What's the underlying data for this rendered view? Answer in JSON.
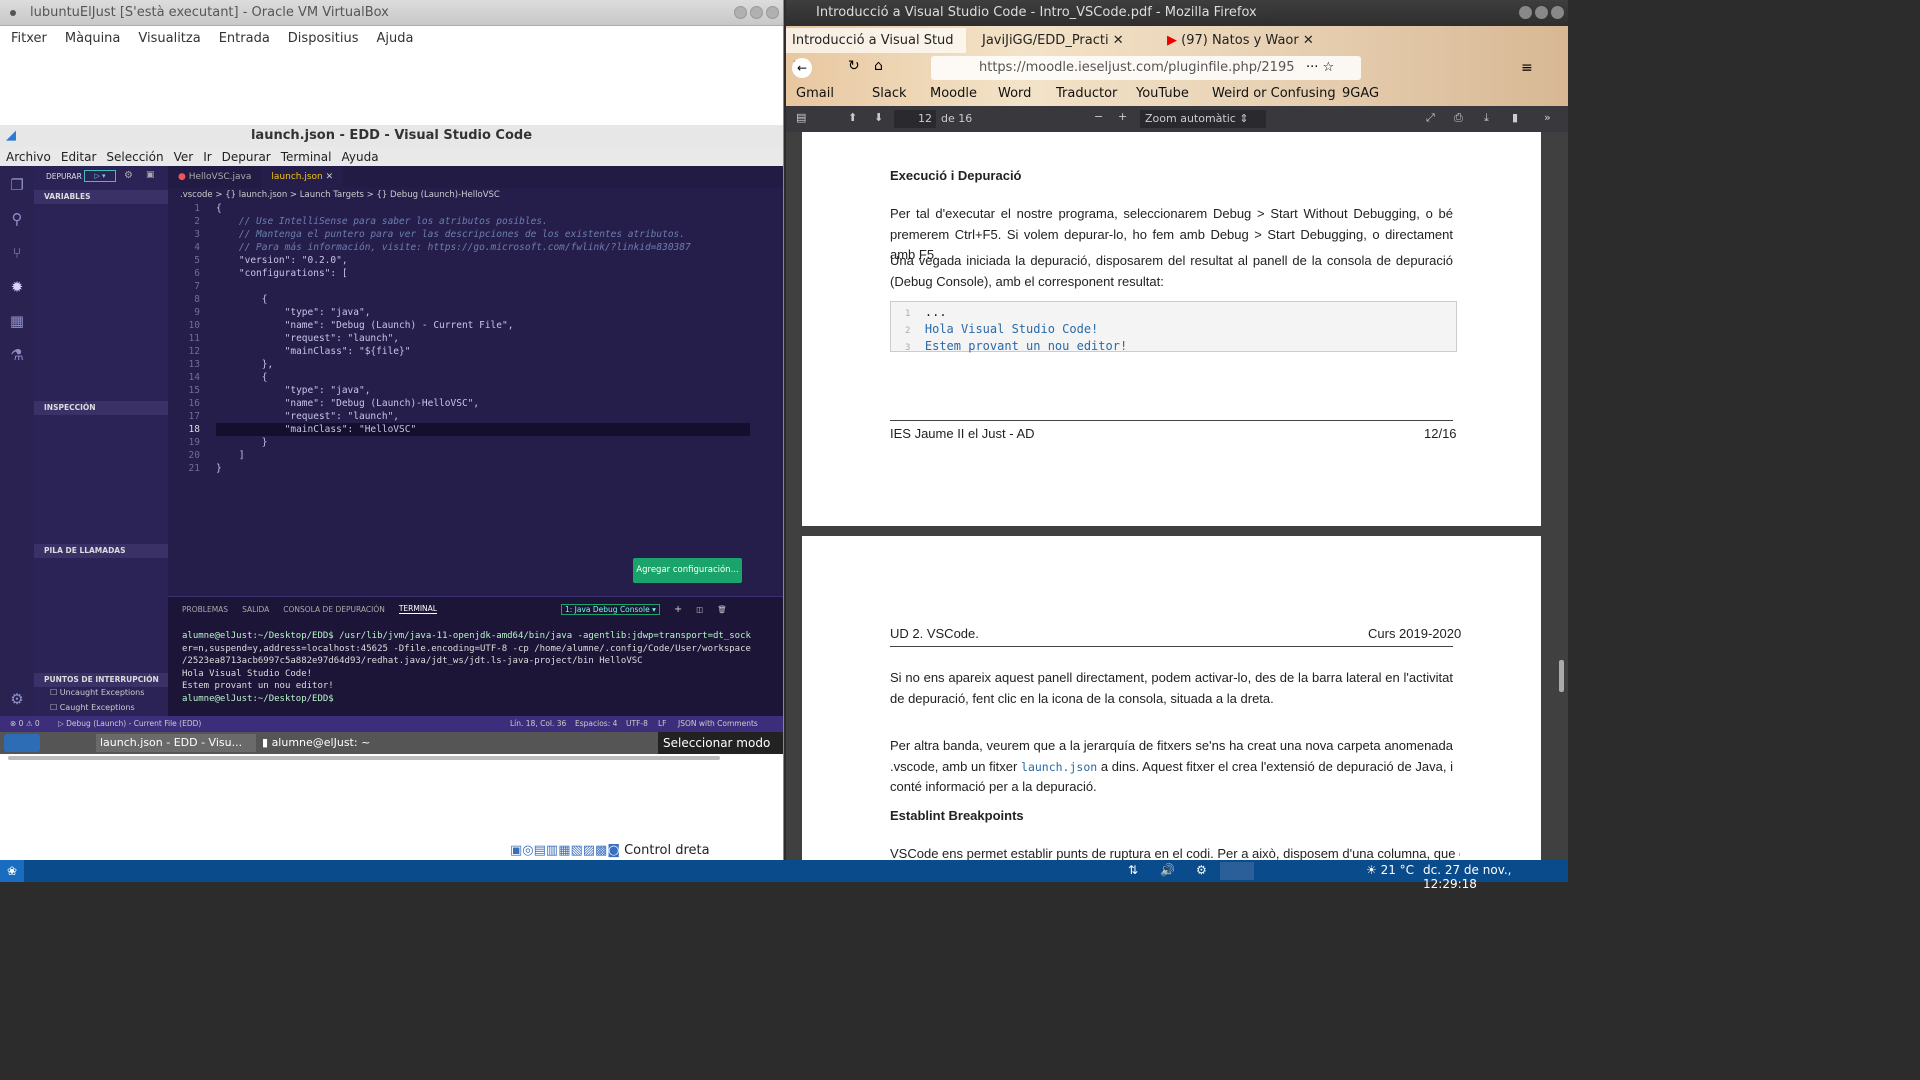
{
  "vbox": {
    "title": "lubuntuElJust [S'està executant] - Oracle VM VirtualBox",
    "menu": [
      "Fitxer",
      "Màquina",
      "Visualitza",
      "Entrada",
      "Dispositius",
      "Ajuda"
    ],
    "hostkey": "Control dreta"
  },
  "vscode": {
    "title": "launch.json - EDD - Visual Studio Code",
    "menu": [
      "Archivo",
      "Editar",
      "Selección",
      "Ver",
      "Ir",
      "Depurar",
      "Terminal",
      "Ayuda"
    ],
    "debug_label": "DEPURAR",
    "sections": {
      "variables": "VARIABLES",
      "watch": "INSPECCIÓN",
      "callstack": "PILA DE LLAMADAS",
      "breakpoints": "PUNTOS DE INTERRUPCIÓN"
    },
    "breakpoint_items": [
      "Uncaught Exceptions",
      "Caught Exceptions"
    ],
    "tabs": [
      "HelloVSC.java",
      "launch.json"
    ],
    "breadcrumb": [
      ".vscode",
      "{} launch.json",
      "Launch Targets",
      "{} Debug (Launch)-HelloVSC"
    ],
    "code_lines": [
      "{",
      "    // Use IntelliSense para saber los atributos posibles.",
      "    // Mantenga el puntero para ver las descripciones de los existentes atributos.",
      "    // Para más información, visite: https://go.microsoft.com/fwlink/?linkid=830387",
      "    \"version\": \"0.2.0\",",
      "    \"configurations\": [",
      "",
      "        {",
      "            \"type\": \"java\",",
      "            \"name\": \"Debug (Launch) - Current File\",",
      "            \"request\": \"launch\",",
      "            \"mainClass\": \"${file}\"",
      "        },",
      "        {",
      "            \"type\": \"java\",",
      "            \"name\": \"Debug (Launch)-HelloVSC\",",
      "            \"request\": \"launch\",",
      "            \"mainClass\": \"HelloVSC\"",
      "        }",
      "    ]",
      "}"
    ],
    "add_config": "Agregar configuración...",
    "panel_tabs": [
      "PROBLEMAS",
      "SALIDA",
      "CONSOLA DE DEPURACIÓN",
      "TERMINAL"
    ],
    "terminal_select": "1: Java Debug Console",
    "terminal_lines": [
      "alumne@elJust:~/Desktop/EDD$ /usr/lib/jvm/java-11-openjdk-amd64/bin/java -agentlib:jdwp=transport=dt_sock",
      "er=n,suspend=y,address=localhost:45625 -Dfile.encoding=UTF-8 -cp /home/alumne/.config/Code/User/workspace",
      "/2523ea8713acb6997c5a882e97d64d93/redhat.java/jdt_ws/jdt.ls-java-project/bin HelloVSC",
      "Hola Visual Studio Code!",
      "Estem provant un nou editor!",
      "alumne@elJust:~/Desktop/EDD$ "
    ],
    "status_left": "⊗ 0  ⚠ 0",
    "status_debug": "Debug (Launch) - Current File (EDD)",
    "status_right": [
      "Lín. 18, Col. 36",
      "Espacios: 4",
      "UTF-8",
      "LF",
      "JSON with Comments"
    ]
  },
  "vm_taskbar": {
    "items": [
      "launch.json - EDD - Visu...",
      "alumne@elJust: ~"
    ],
    "tooltip": "Seleccionar modo de"
  },
  "firefox": {
    "title": "Introducció a Visual Studio Code - Intro_VSCode.pdf - Mozilla Firefox",
    "tabs": [
      "Introducció a Visual Stud",
      "JaviJiGG/EDD_Practi",
      "(97) Natos y Waor"
    ],
    "url": "https://moodle.ieseljust.com/pluginfile.php/2195",
    "bookmarks": [
      "Gmail",
      "Slack",
      "Moodle",
      "Word",
      "Traductor",
      "YouTube",
      "Weird or Confusing",
      "9GAG"
    ],
    "page_num": "12",
    "page_total": "de 16",
    "zoom": "Zoom automàtic"
  },
  "pdf": {
    "heading1": "Execució i Depuració",
    "para1": "Per tal d'executar el nostre programa, seleccionarem Debug > Start Without Debugging, o bé premerem Ctrl+F5. Si volem depurar-lo, ho fem amb Debug > Start Debugging, o directament amb F5.",
    "para2": "Una vegada iniciada la depuració, disposarem del resultat al panell de la consola de depuració (Debug Console), amb el corresponent resultat:",
    "code": [
      "...",
      "Hola Visual Studio Code!",
      "Estem provant un nou editor!"
    ],
    "footer_left": "IES Jaume II el Just - AD",
    "footer_right": "12/16",
    "header_left": "UD 2. VSCode.",
    "header_right": "Curs 2019-2020",
    "para3": "Si no ens apareix aquest panell directament, podem activar-lo, des de la barra lateral en l'activitat de depuració, fent clic en la icona de la consola, situada a la dreta.",
    "para4a": "Per altra banda, veurem que a la jerarquía de fitxers se'ns ha creat una nova carpeta anomenada .vscode, amb un fitxer",
    "para4code": "launch.json",
    "para4b": "a dins. Aquest fitxer el crea l'extensió de depuració de Java, i conté informació per a la depuració.",
    "heading2": "Establint Breakpoints",
    "para5": "VSCode ens permet establir punts de ruptura en el codi. Per a això, disposem d'una columna, que ens"
  },
  "host": {
    "temp": "21 °C",
    "datetime": "dc. 27 de nov., 12:29:18"
  }
}
